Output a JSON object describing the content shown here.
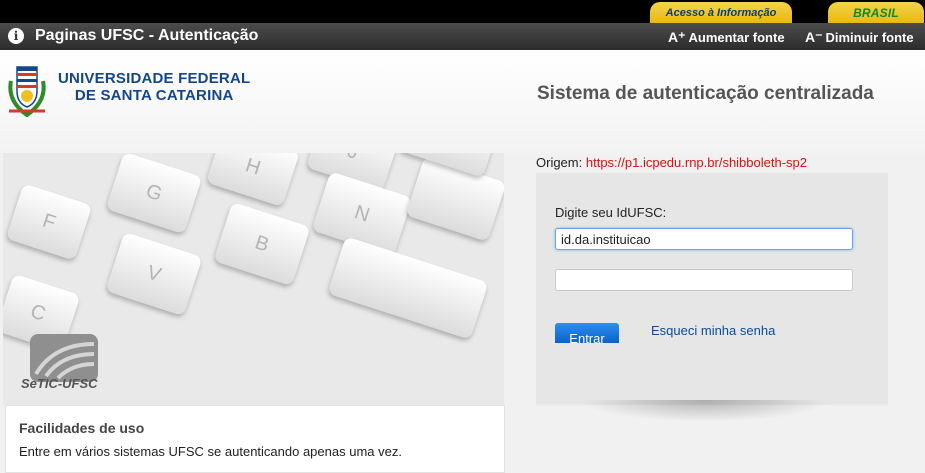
{
  "gov_bar": {
    "info_tab": "Acesso à Informação",
    "brasil_tab": "BRASIL"
  },
  "title_bar": {
    "title": "Paginas UFSC - Autenticação",
    "increase_font": "Aumentar fonte",
    "decrease_font": "Diminuir fonte"
  },
  "header": {
    "university_line1": "UNIVERSIDADE FEDERAL",
    "university_line2": "DE SANTA CATARINA",
    "system_title": "Sistema de autenticação centralizada"
  },
  "hero": {
    "keys": [
      "F",
      "G",
      "H",
      "J",
      "C",
      "V",
      "B",
      "N"
    ],
    "brand": "SeTIC-UFSC"
  },
  "facilities": {
    "title": "Facilidades de uso",
    "text": "Entre em vários sistemas UFSC se autenticando apenas uma vez."
  },
  "login": {
    "origin_label": "Origem:",
    "origin_url": "https://p1.icpedu.rnp.br/shibboleth-sp2",
    "id_label": "Digite seu IdUFSC:",
    "id_value": "id.da.instituicao",
    "password_value": "",
    "submit_label": "Entrar",
    "forgot_link": "Esqueci minha senha"
  },
  "colors": {
    "accent_blue": "#14468c",
    "button_blue": "#1a73d8",
    "origin_red": "#e01010",
    "gov_yellow": "#f4d44a"
  }
}
